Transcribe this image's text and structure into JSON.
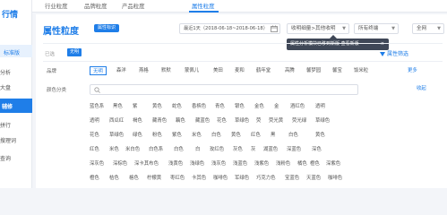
{
  "sidebar": {
    "title": "行情",
    "items": [
      {
        "label": "标准版"
      },
      {
        "label": "分析"
      },
      {
        "label": "大盘"
      },
      {
        "label": "辅修"
      },
      {
        "label": "拼行"
      },
      {
        "label": "搜理词"
      },
      {
        "label": "查询"
      }
    ]
  },
  "tabs": [
    "行业粒度",
    "品牌粒度",
    "产品粒度",
    "属性粒度"
  ],
  "active_tab": "属性粒度",
  "panel": {
    "title": "属性粒度",
    "title_tag": "属性标识",
    "date_range": "最近1天（2018-06-18~2018-06-18）",
    "terminal_select": "收明细量>其他收明",
    "terminal_select2": "所有终端",
    "scope_select": "全网",
    "tooltip": "属性分析模块已移到新版·查看新版",
    "tooltip_close": "×"
  },
  "filter": {
    "label": "已选",
    "selected": "无明",
    "attr_filter_label": "属性筛选"
  },
  "brand_row": {
    "label": "品牌",
    "items": [
      "无明",
      "森洋",
      "燕格",
      "默默",
      "蒙佩儿",
      "美田",
      "麦和",
      "鹤年堂",
      "高腾",
      "馨梦园",
      "馨宝",
      "饭米粒"
    ],
    "more": "更多"
  },
  "color_row": {
    "label": "颜色分类",
    "search_placeholder": "",
    "collapse": "收起",
    "rows": [
      [
        "蓝色系",
        "黑色",
        "紫",
        "黄色",
        "蛇色",
        "香槟色",
        "青色",
        "银色",
        "金色",
        "金",
        "酒红色",
        "透明"
      ],
      [
        "透明",
        "西瓜红",
        "褐色",
        "藏青色",
        "藕色",
        "藏蓝色",
        "花色",
        "草绿色",
        "荧",
        "荧光黄",
        "荧光绿",
        "草绿色"
      ],
      [
        "花色",
        "草绿色",
        "绿色",
        "粉色",
        "紫色",
        "米色",
        "白色",
        "黄色",
        "红色",
        "黑",
        "白色",
        "黄色"
      ],
      [
        "红色",
        "米色",
        "米白色",
        "白色系",
        "白色",
        "白",
        "玫红色",
        "灰色",
        "灰",
        "湖蓝色",
        "深蓝色",
        "深色"
      ],
      [
        "深灰色",
        "深棕色",
        "深卡其布色",
        "浅黄色",
        "浅绿色",
        "浅灰色",
        "浅蓝色",
        "浅紫色",
        "浅粉色",
        "橘色",
        "橙色",
        "深紫色"
      ],
      [
        "橙色",
        "桔色",
        "格色",
        "柠檬黄",
        "枣红色",
        "卡其色",
        "咖啡色",
        "军绿色",
        "巧克力色",
        "宝蓝色",
        "天蓝色",
        "咖啡色"
      ]
    ]
  }
}
